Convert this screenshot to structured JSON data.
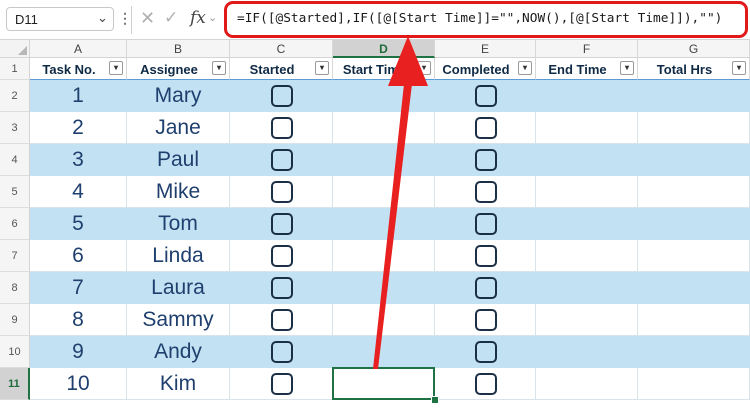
{
  "name_box": {
    "value": "D11",
    "icon": "chevron-down-icon"
  },
  "formula_bar": {
    "formula": "=IF([@Started],IF([@[Start Time]]=\"\",NOW(),[@[Start Time]]),\"\")",
    "icons": [
      "more-dots-icon",
      "cancel-icon",
      "enter-check-icon",
      "fx-icon",
      "chevron-down-icon"
    ],
    "highlight_color": "#e11919"
  },
  "grid": {
    "columns": [
      "A",
      "B",
      "C",
      "D",
      "E",
      "F",
      "G"
    ],
    "selected_column": "D",
    "rows": [
      "1",
      "2",
      "3",
      "4",
      "5",
      "6",
      "7",
      "8",
      "9",
      "10",
      "11"
    ],
    "selected_row": "11",
    "selected_cell": "D11",
    "band_color": "#c2e2f4",
    "selection_color": "#1f7244"
  },
  "table": {
    "headers": [
      "Task No.",
      "Assignee",
      "Started",
      "Start Time",
      "Completed",
      "End Time",
      "Total Hrs"
    ],
    "rows": [
      {
        "task": "1",
        "assignee": "Mary",
        "started": false,
        "completed": false
      },
      {
        "task": "2",
        "assignee": "Jane",
        "started": false,
        "completed": false
      },
      {
        "task": "3",
        "assignee": "Paul",
        "started": false,
        "completed": false
      },
      {
        "task": "4",
        "assignee": "Mike",
        "started": false,
        "completed": false
      },
      {
        "task": "5",
        "assignee": "Tom",
        "started": false,
        "completed": false
      },
      {
        "task": "6",
        "assignee": "Linda",
        "started": false,
        "completed": false
      },
      {
        "task": "7",
        "assignee": "Laura",
        "started": false,
        "completed": false
      },
      {
        "task": "8",
        "assignee": "Sammy",
        "started": false,
        "completed": false
      },
      {
        "task": "9",
        "assignee": "Andy",
        "started": false,
        "completed": false
      },
      {
        "task": "10",
        "assignee": "Kim",
        "started": false,
        "completed": false
      }
    ]
  },
  "annotation": {
    "type": "arrow",
    "color": "#e8201f"
  }
}
